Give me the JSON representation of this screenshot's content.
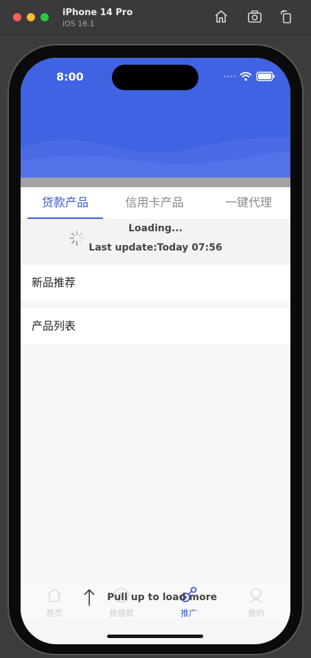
{
  "simulator": {
    "device_name": "iPhone 14 Pro",
    "os_version": "iOS 16.1"
  },
  "status_bar": {
    "time": "8:00"
  },
  "tabs": [
    {
      "label": "贷款产品",
      "active": true
    },
    {
      "label": "信用卡产品",
      "active": false
    },
    {
      "label": "一键代理",
      "active": false
    }
  ],
  "refresh": {
    "loading": "Loading...",
    "last_update": "Last update:Today 07:56"
  },
  "sections": {
    "new_products": "新品推荐",
    "product_list": "产品列表"
  },
  "pull_up": {
    "text": "Pull up to load more"
  },
  "tabbar": [
    {
      "label": "首页",
      "icon": "home-icon",
      "active": false
    },
    {
      "label": "我借款",
      "icon": "money-icon",
      "active": false
    },
    {
      "label": "推广",
      "icon": "share-icon",
      "active": true
    },
    {
      "label": "我的",
      "icon": "user-icon",
      "active": false
    }
  ],
  "colors": {
    "brand": "#3f63e3",
    "active_tab": "#3a5cd4"
  }
}
